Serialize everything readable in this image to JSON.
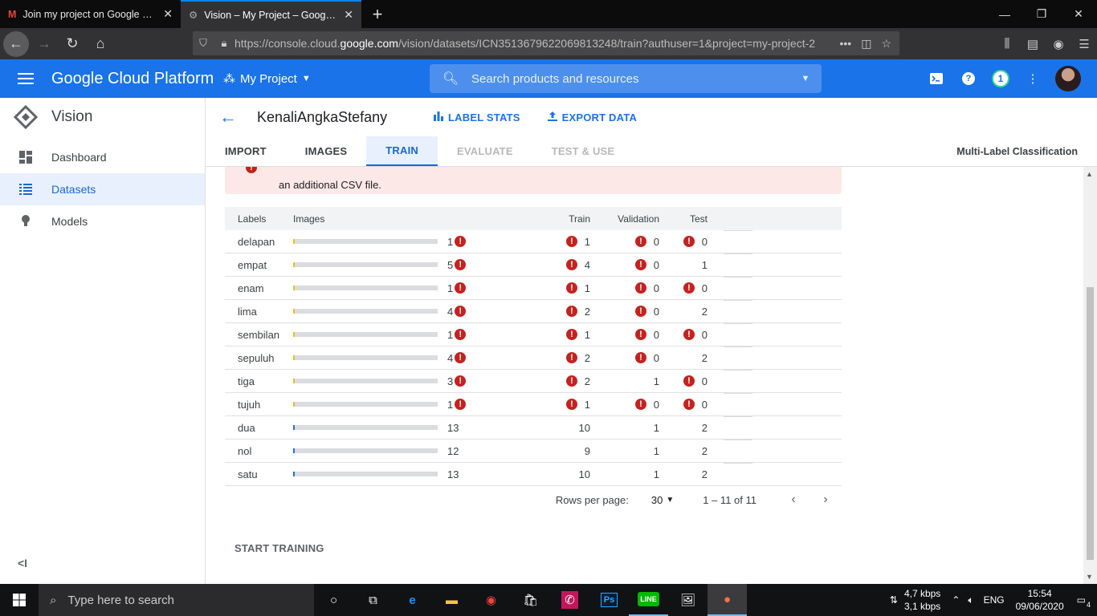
{
  "browser": {
    "tabs": [
      {
        "label": "Join my project on Google Dev",
        "icon": "gmail-icon",
        "active": false
      },
      {
        "label": "Vision – My Project – Google Cl",
        "icon": "gcp-icon",
        "active": true
      }
    ],
    "url_prefix": "https://console.cloud.",
    "url_domain": "google.com",
    "url_rest": "/vision/datasets/ICN3513679622069813248/train?authuser=1&project=my-project-2"
  },
  "gcp": {
    "logo_text": "Google Cloud Platform",
    "project": "My Project",
    "search_placeholder": "Search products and resources",
    "notification_count": "1",
    "accent": "#1a73e8"
  },
  "sidebar": {
    "title": "Vision",
    "items": [
      {
        "label": "Dashboard",
        "icon": "dashboard-icon"
      },
      {
        "label": "Datasets",
        "icon": "list-icon",
        "active": true
      },
      {
        "label": "Models",
        "icon": "lightbulb-icon"
      }
    ],
    "collapse_label": "<I"
  },
  "dataset": {
    "title": "KenaliAngkaStefany",
    "label_stats": "LABEL STATS",
    "export_data": "EXPORT DATA",
    "classification": "Multi-Label Classification"
  },
  "tabs": [
    {
      "label": "IMPORT",
      "state": "normal"
    },
    {
      "label": "IMAGES",
      "state": "normal"
    },
    {
      "label": "TRAIN",
      "state": "active"
    },
    {
      "label": "EVALUATE",
      "state": "disabled"
    },
    {
      "label": "TEST & USE",
      "state": "disabled"
    }
  ],
  "alert": {
    "text": "an additional CSV file."
  },
  "table": {
    "headers": {
      "labels": "Labels",
      "images": "Images",
      "train": "Train",
      "validation": "Validation",
      "test": "Test"
    },
    "rows": [
      {
        "label": "delapan",
        "images": "1",
        "img_err": true,
        "img_frac": 0.0,
        "train": "1",
        "train_err": true,
        "val": "0",
        "val_err": true,
        "test": "0",
        "test_err": true
      },
      {
        "label": "empat",
        "images": "5",
        "img_err": true,
        "img_frac": 0.01,
        "train": "4",
        "train_err": true,
        "val": "0",
        "val_err": true,
        "test": "1",
        "test_err": false
      },
      {
        "label": "enam",
        "images": "1",
        "img_err": true,
        "img_frac": 0.0,
        "train": "1",
        "train_err": true,
        "val": "0",
        "val_err": true,
        "test": "0",
        "test_err": true
      },
      {
        "label": "lima",
        "images": "4",
        "img_err": true,
        "img_frac": 0.01,
        "train": "2",
        "train_err": true,
        "val": "0",
        "val_err": true,
        "test": "2",
        "test_err": false
      },
      {
        "label": "sembilan",
        "images": "1",
        "img_err": true,
        "img_frac": 0.0,
        "train": "1",
        "train_err": true,
        "val": "0",
        "val_err": true,
        "test": "0",
        "test_err": true
      },
      {
        "label": "sepuluh",
        "images": "4",
        "img_err": true,
        "img_frac": 0.01,
        "train": "2",
        "train_err": true,
        "val": "0",
        "val_err": true,
        "test": "2",
        "test_err": false
      },
      {
        "label": "tiga",
        "images": "3",
        "img_err": true,
        "img_frac": 0.0,
        "train": "2",
        "train_err": true,
        "val": "1",
        "val_err": false,
        "test": "0",
        "test_err": true
      },
      {
        "label": "tujuh",
        "images": "1",
        "img_err": true,
        "img_frac": 0.0,
        "train": "1",
        "train_err": true,
        "val": "0",
        "val_err": true,
        "test": "0",
        "test_err": true
      },
      {
        "label": "dua",
        "images": "13",
        "img_err": false,
        "img_frac": 0.012,
        "train": "10",
        "train_err": false,
        "val": "1",
        "val_err": false,
        "test": "2",
        "test_err": false
      },
      {
        "label": "nol",
        "images": "12",
        "img_err": false,
        "img_frac": 0.011,
        "train": "9",
        "train_err": false,
        "val": "1",
        "val_err": false,
        "test": "2",
        "test_err": false
      },
      {
        "label": "satu",
        "images": "13",
        "img_err": false,
        "img_frac": 0.012,
        "train": "10",
        "train_err": false,
        "val": "1",
        "val_err": false,
        "test": "2",
        "test_err": false
      }
    ]
  },
  "pager": {
    "rows_per_page_label": "Rows per page:",
    "rows_per_page": "30",
    "range": "1 – 11 of 11"
  },
  "start_training": "START TRAINING",
  "taskbar": {
    "search_placeholder": "Type here to search",
    "download_speed": "4,7 kbps",
    "upload_speed": "3,1 kbps",
    "language": "ENG",
    "time": "15:54",
    "date": "09/06/2020",
    "notifications": "4"
  }
}
